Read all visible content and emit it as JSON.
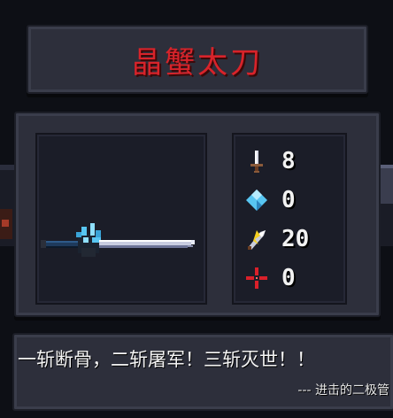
{
  "weapon": {
    "name": "晶蟹太刀",
    "image": "crystal-crab-katana-sprite"
  },
  "stats": [
    {
      "icon": "sword-icon",
      "label": "damage",
      "value": "8"
    },
    {
      "icon": "energy-crystal-icon",
      "label": "energy",
      "value": "0"
    },
    {
      "icon": "critical-icon",
      "label": "critical",
      "value": "20"
    },
    {
      "icon": "crosshair-icon",
      "label": "inaccuracy",
      "value": "0"
    }
  ],
  "quote": {
    "text": "一斩断骨，二斩屠军！三斩灭世！！",
    "author": "--- 进击的二极管"
  },
  "colors": {
    "title_red": "#d8232a",
    "panel": "#2d2f3b",
    "inner_frame": "#1b1d28",
    "crystal_blue": "#58c6f2"
  }
}
